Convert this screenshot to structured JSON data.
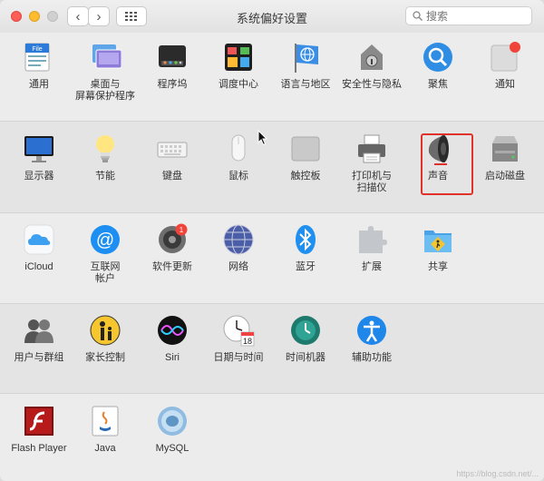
{
  "window": {
    "title": "系统偏好设置"
  },
  "toolbar": {
    "back": "‹",
    "forward": "›",
    "search_placeholder": "搜索"
  },
  "rows": [
    [
      {
        "label": "通用",
        "icon": "general-icon"
      },
      {
        "label": "桌面与\n屏幕保护程序",
        "icon": "desktop-screensaver-icon"
      },
      {
        "label": "程序坞",
        "icon": "dock-icon"
      },
      {
        "label": "调度中心",
        "icon": "mission-control-icon"
      },
      {
        "label": "语言与地区",
        "icon": "language-region-icon"
      },
      {
        "label": "安全性与隐私",
        "icon": "security-privacy-icon"
      },
      {
        "label": "聚焦",
        "icon": "spotlight-icon"
      },
      {
        "label": "通知",
        "icon": "notifications-icon"
      }
    ],
    [
      {
        "label": "显示器",
        "icon": "displays-icon"
      },
      {
        "label": "节能",
        "icon": "energy-saver-icon"
      },
      {
        "label": "键盘",
        "icon": "keyboard-icon"
      },
      {
        "label": "鼠标",
        "icon": "mouse-icon"
      },
      {
        "label": "触控板",
        "icon": "trackpad-icon"
      },
      {
        "label": "打印机与\n扫描仪",
        "icon": "printer-scanner-icon"
      },
      {
        "label": "声音",
        "icon": "sound-icon"
      },
      {
        "label": "启动磁盘",
        "icon": "startup-disk-icon"
      }
    ],
    [
      {
        "label": "iCloud",
        "icon": "icloud-icon"
      },
      {
        "label": "互联网\n帐户",
        "icon": "internet-accounts-icon"
      },
      {
        "label": "软件更新",
        "icon": "software-update-icon",
        "badge": "1"
      },
      {
        "label": "网络",
        "icon": "network-icon"
      },
      {
        "label": "蓝牙",
        "icon": "bluetooth-icon"
      },
      {
        "label": "扩展",
        "icon": "extensions-icon"
      },
      {
        "label": "共享",
        "icon": "sharing-icon"
      }
    ],
    [
      {
        "label": "用户与群组",
        "icon": "users-groups-icon"
      },
      {
        "label": "家长控制",
        "icon": "parental-controls-icon"
      },
      {
        "label": "Siri",
        "icon": "siri-icon"
      },
      {
        "label": "日期与时间",
        "icon": "date-time-icon",
        "date_num": "18"
      },
      {
        "label": "时间机器",
        "icon": "time-machine-icon"
      },
      {
        "label": "辅助功能",
        "icon": "accessibility-icon"
      }
    ],
    [
      {
        "label": "Flash Player",
        "icon": "flash-player-icon"
      },
      {
        "label": "Java",
        "icon": "java-icon"
      },
      {
        "label": "MySQL",
        "icon": "mysql-icon"
      }
    ]
  ],
  "watermark": "https://blog.csdn.net/..."
}
